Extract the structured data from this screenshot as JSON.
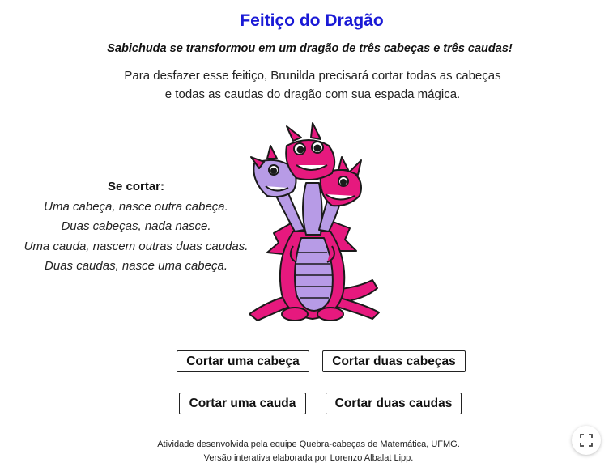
{
  "header": {
    "title": "Feitiço do Dragão",
    "subtitle": "Sabichuda se transformou em um dragão de três cabeças e três caudas!",
    "intro_lines": [
      "Para desfazer esse feitiço, Brunilda precisará cortar todas as cabeças",
      "e todas as caudas do dragão com sua espada mágica."
    ]
  },
  "rules": {
    "heading": "Se cortar:",
    "lines": [
      "Uma cabeça, nasce outra cabeça.",
      "Duas cabeças, nada nasce.",
      "Uma cauda, nascem outras duas caudas.",
      "Duas caudas, nasce uma cabeça."
    ]
  },
  "illustration": {
    "icon": "three-headed-dragon",
    "colors": {
      "body": "#e6197e",
      "belly": "#b79be6",
      "outline": "#1a1a1a"
    }
  },
  "buttons": {
    "cut_one_head": "Cortar uma cabeça",
    "cut_two_heads": "Cortar duas cabeças",
    "cut_one_tail": "Cortar uma cauda",
    "cut_two_tails": "Cortar duas caudas"
  },
  "footer": {
    "line1": "Atividade desenvolvida pela equipe Quebra-cabeças de Matemática, UFMG.",
    "line2": "Versão interativa elaborada por Lorenzo Albalat Lipp."
  },
  "controls": {
    "fullscreen_icon": "fullscreen-icon"
  }
}
